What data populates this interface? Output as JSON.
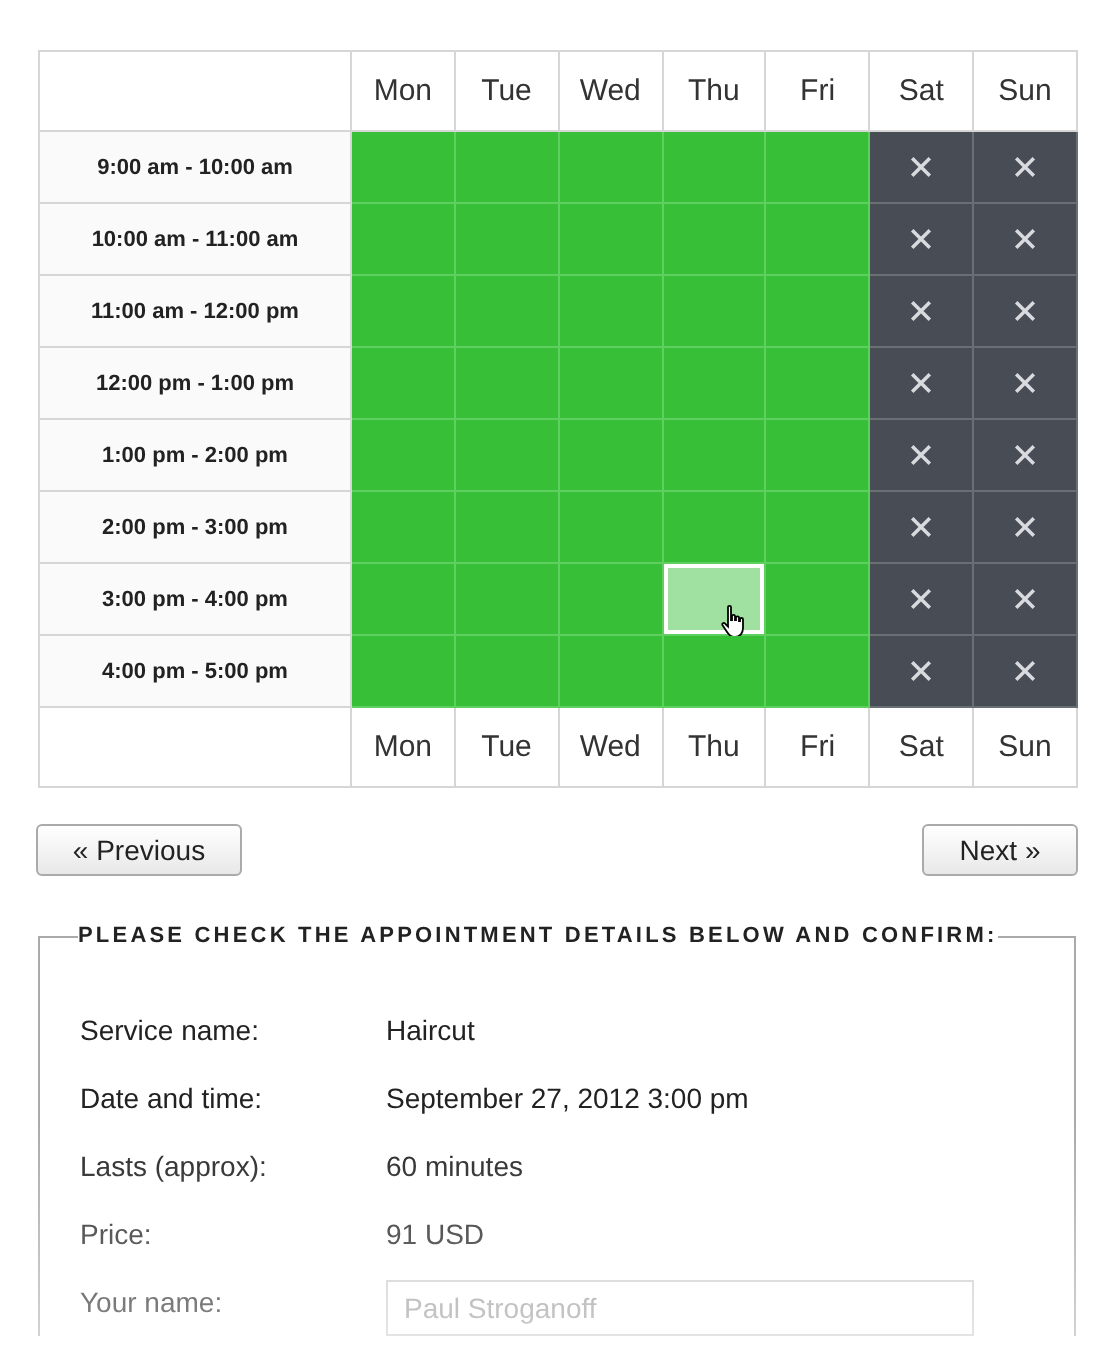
{
  "schedule": {
    "header_days": [
      "Mon",
      "Tue",
      "Wed",
      "Thu",
      "Fri",
      "Sat",
      "Sun"
    ],
    "rows": [
      {
        "time": "9:00 am - 10:00 am",
        "slots": [
          {
            "available": true,
            "highlighted": false
          },
          {
            "available": true,
            "highlighted": false
          },
          {
            "available": true,
            "highlighted": false
          },
          {
            "available": true,
            "highlighted": false
          },
          {
            "available": true,
            "highlighted": false
          },
          {
            "available": false,
            "highlighted": false
          },
          {
            "available": false,
            "highlighted": false
          }
        ]
      },
      {
        "time": "10:00 am - 11:00 am",
        "slots": [
          {
            "available": true,
            "highlighted": false
          },
          {
            "available": true,
            "highlighted": false
          },
          {
            "available": true,
            "highlighted": false
          },
          {
            "available": true,
            "highlighted": false
          },
          {
            "available": true,
            "highlighted": false
          },
          {
            "available": false,
            "highlighted": false
          },
          {
            "available": false,
            "highlighted": false
          }
        ]
      },
      {
        "time": "11:00 am - 12:00 pm",
        "slots": [
          {
            "available": true,
            "highlighted": false
          },
          {
            "available": true,
            "highlighted": false
          },
          {
            "available": true,
            "highlighted": false
          },
          {
            "available": true,
            "highlighted": false
          },
          {
            "available": true,
            "highlighted": false
          },
          {
            "available": false,
            "highlighted": false
          },
          {
            "available": false,
            "highlighted": false
          }
        ]
      },
      {
        "time": "12:00 pm - 1:00 pm",
        "slots": [
          {
            "available": true,
            "highlighted": false
          },
          {
            "available": true,
            "highlighted": false
          },
          {
            "available": true,
            "highlighted": false
          },
          {
            "available": true,
            "highlighted": false
          },
          {
            "available": true,
            "highlighted": false
          },
          {
            "available": false,
            "highlighted": false
          },
          {
            "available": false,
            "highlighted": false
          }
        ]
      },
      {
        "time": "1:00 pm - 2:00 pm",
        "slots": [
          {
            "available": true,
            "highlighted": false
          },
          {
            "available": true,
            "highlighted": false
          },
          {
            "available": true,
            "highlighted": false
          },
          {
            "available": true,
            "highlighted": false
          },
          {
            "available": true,
            "highlighted": false
          },
          {
            "available": false,
            "highlighted": false
          },
          {
            "available": false,
            "highlighted": false
          }
        ]
      },
      {
        "time": "2:00 pm - 3:00 pm",
        "slots": [
          {
            "available": true,
            "highlighted": false
          },
          {
            "available": true,
            "highlighted": false
          },
          {
            "available": true,
            "highlighted": false
          },
          {
            "available": true,
            "highlighted": false
          },
          {
            "available": true,
            "highlighted": false
          },
          {
            "available": false,
            "highlighted": false
          },
          {
            "available": false,
            "highlighted": false
          }
        ]
      },
      {
        "time": "3:00 pm - 4:00 pm",
        "slots": [
          {
            "available": true,
            "highlighted": false
          },
          {
            "available": true,
            "highlighted": false
          },
          {
            "available": true,
            "highlighted": false
          },
          {
            "available": true,
            "highlighted": true
          },
          {
            "available": true,
            "highlighted": false
          },
          {
            "available": false,
            "highlighted": false
          },
          {
            "available": false,
            "highlighted": false
          }
        ]
      },
      {
        "time": "4:00 pm - 5:00 pm",
        "slots": [
          {
            "available": true,
            "highlighted": false
          },
          {
            "available": true,
            "highlighted": false
          },
          {
            "available": true,
            "highlighted": false
          },
          {
            "available": true,
            "highlighted": false
          },
          {
            "available": true,
            "highlighted": false
          },
          {
            "available": false,
            "highlighted": false
          },
          {
            "available": false,
            "highlighted": false
          }
        ]
      }
    ],
    "footer_days": [
      "Mon",
      "Tue",
      "Wed",
      "Thu",
      "Fri",
      "Sat",
      "Sun"
    ]
  },
  "navigation": {
    "previous": "« Previous",
    "next": "Next »"
  },
  "confirmation": {
    "legend": "PLEASE CHECK THE APPOINTMENT DETAILS BELOW AND CONFIRM:",
    "details": [
      {
        "kind": "text",
        "label": "Service name:",
        "value": "Haircut"
      },
      {
        "kind": "text",
        "label": "Date and time:",
        "value": "September 27, 2012 3:00 pm"
      },
      {
        "kind": "text",
        "label": "Lasts (approx):",
        "value": "60 minutes"
      },
      {
        "kind": "text",
        "label": "Price:",
        "value": "91 USD"
      },
      {
        "kind": "input",
        "label": "Your name:",
        "placeholder": "Paul Stroganoff"
      }
    ]
  }
}
